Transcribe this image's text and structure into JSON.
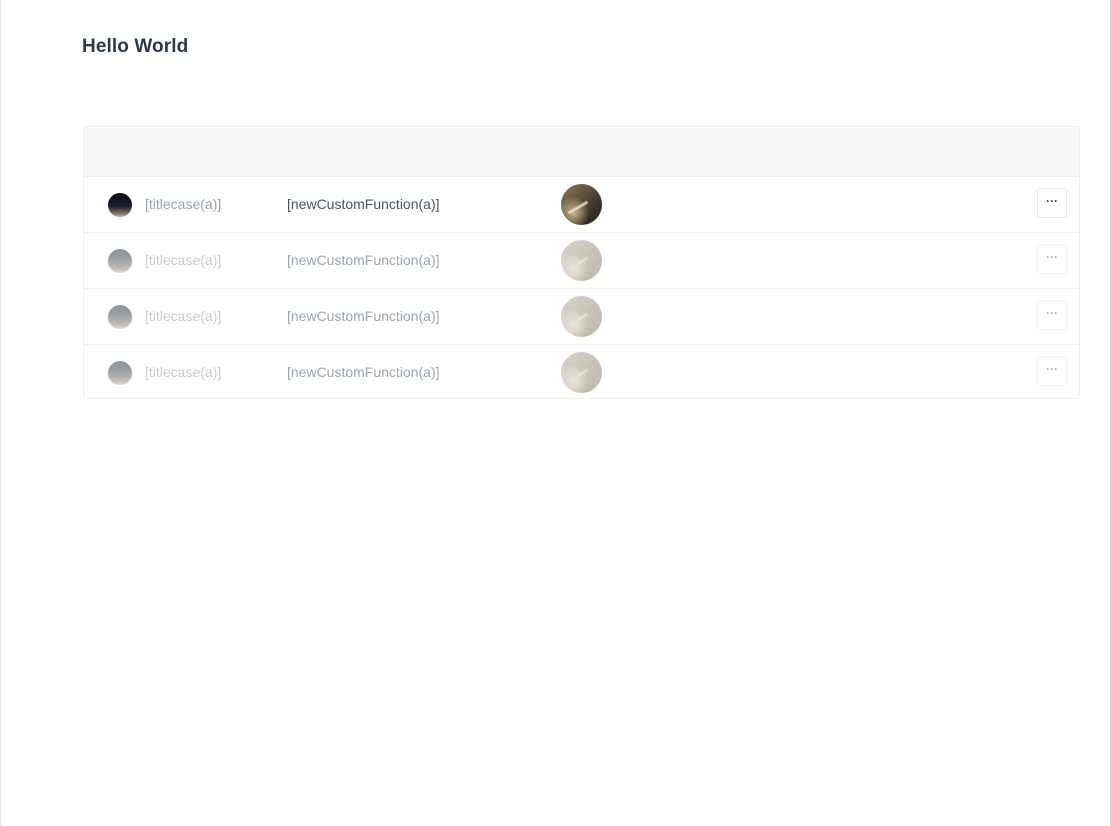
{
  "page": {
    "title": "Hello World"
  },
  "list": {
    "rows": [
      {
        "title_cell": "[titlecase(a)]",
        "func_cell": "[newCustomFunction(a)]",
        "menu_label": "···",
        "state": "active"
      },
      {
        "title_cell": "[titlecase(a)]",
        "func_cell": "[newCustomFunction(a)]",
        "menu_label": "···",
        "state": "placeholder"
      },
      {
        "title_cell": "[titlecase(a)]",
        "func_cell": "[newCustomFunction(a)]",
        "menu_label": "···",
        "state": "placeholder"
      },
      {
        "title_cell": "[titlecase(a)]",
        "func_cell": "[newCustomFunction(a)]",
        "menu_label": "···",
        "state": "placeholder"
      }
    ]
  },
  "icons": {
    "row_avatar": "avatar-image",
    "row_photo": "photo-thumbnail",
    "row_menu": "more-options-icon"
  },
  "colors": {
    "title_text": "#2f3942",
    "header_background": "#f7f8f7",
    "border": "#eceeee"
  }
}
